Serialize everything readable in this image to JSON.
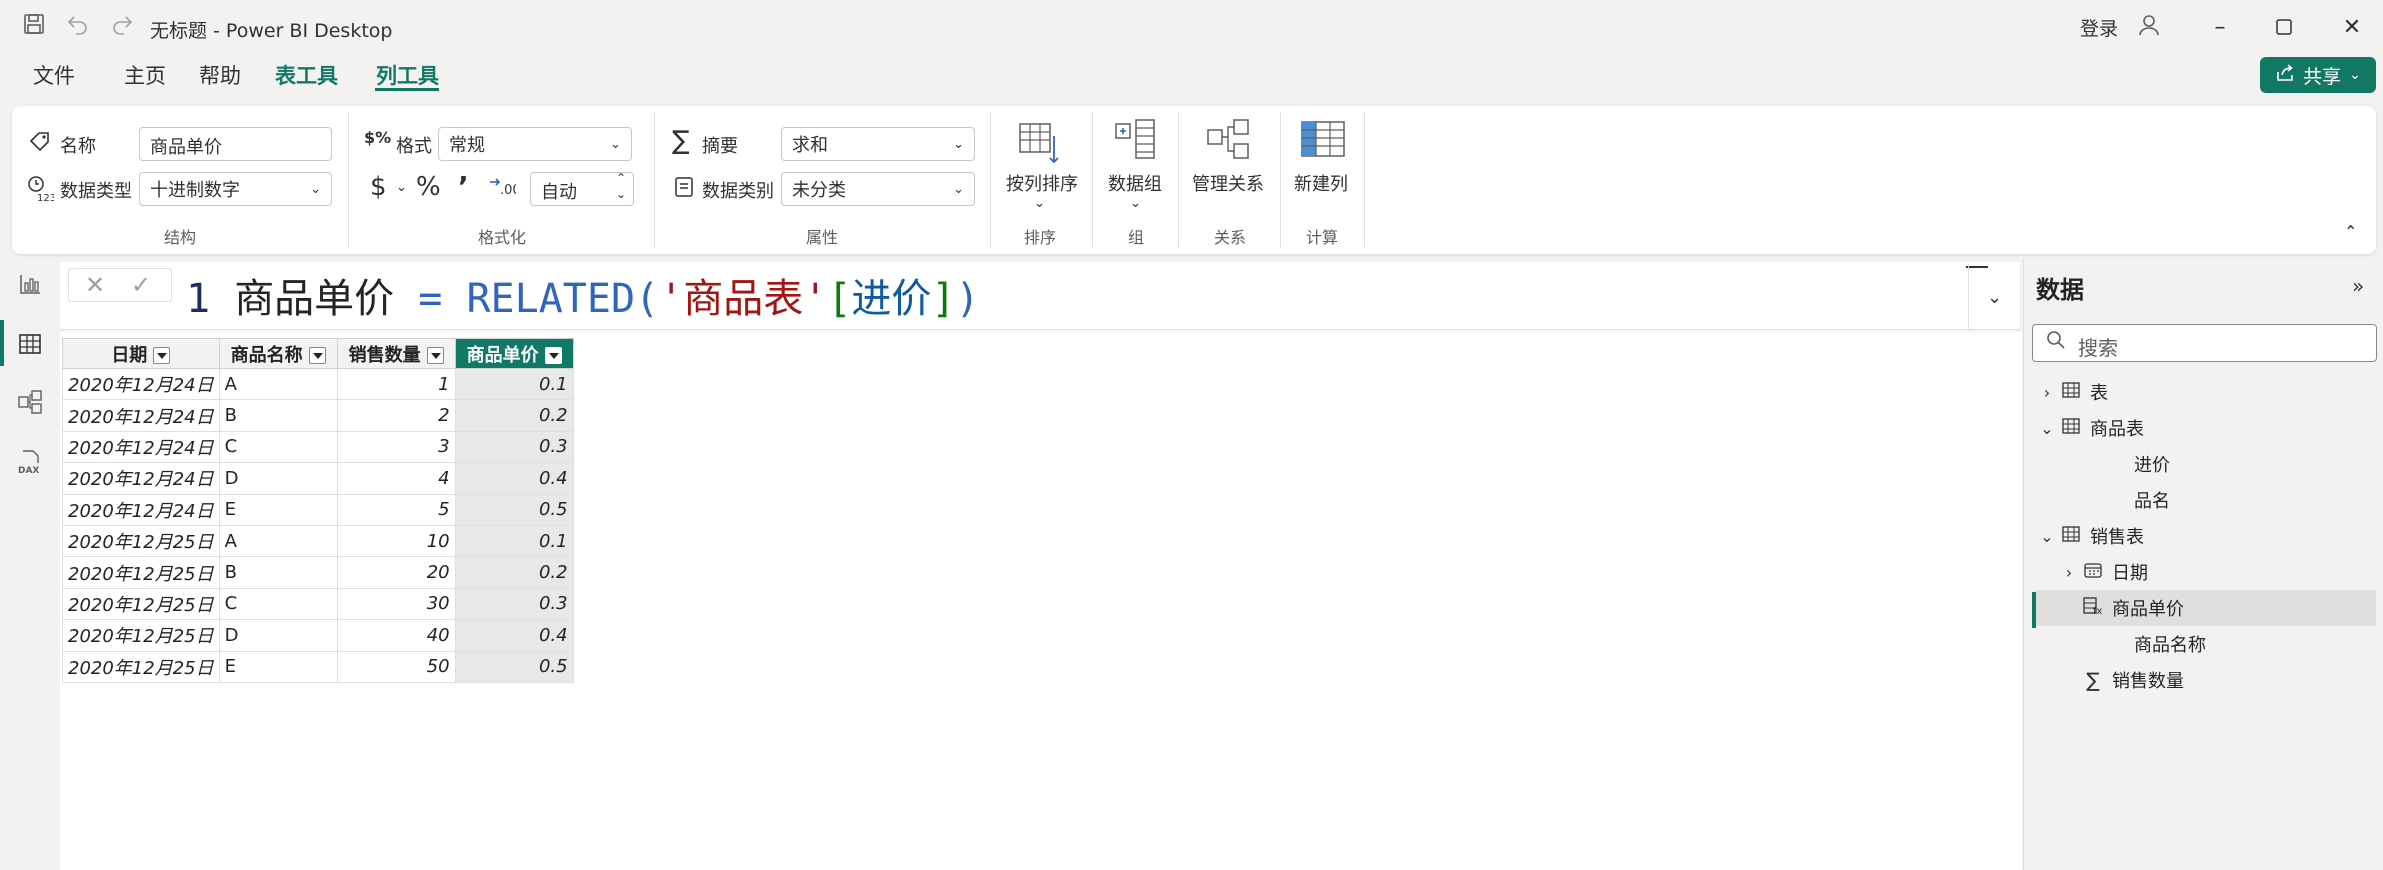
{
  "window": {
    "title": "无标题 - Power BI Desktop",
    "login": "登录"
  },
  "menu": {
    "file": "文件",
    "home": "主页",
    "help": "帮助",
    "table_tools": "表工具",
    "column_tools": "列工具",
    "share": "共享"
  },
  "ribbon": {
    "structure": {
      "name_label": "名称",
      "name_value": "商品单价",
      "datatype_label": "数据类型",
      "datatype_value": "十进制数字",
      "group": "结构"
    },
    "formatting": {
      "format_label": "格式",
      "format_value": "常规",
      "currency": "$",
      "percent": "%",
      "comma": "’",
      "decimals_value": "自动",
      "group": "格式化"
    },
    "properties": {
      "summary_label": "摘要",
      "summary_value": "求和",
      "category_label": "数据类别",
      "category_value": "未分类",
      "group": "属性"
    },
    "sort": {
      "button": "按列排序",
      "group": "排序"
    },
    "groups": {
      "button": "数据组",
      "group": "组"
    },
    "relations": {
      "button": "管理关系",
      "group": "关系"
    },
    "calc": {
      "button": "新建列",
      "group": "计算"
    }
  },
  "formula": {
    "line_no": "1",
    "name": "商品单价",
    "eq": "=",
    "func": "RELATED",
    "open": "(",
    "table": "'商品表'",
    "bracket_open": "[",
    "column": "进价",
    "bracket_close": "]",
    "close": ")"
  },
  "table": {
    "headers": [
      "日期",
      "商品名称",
      "销售数量",
      "商品单价"
    ],
    "rows": [
      [
        "2020年12月24日",
        "A",
        "1",
        "0.1"
      ],
      [
        "2020年12月24日",
        "B",
        "2",
        "0.2"
      ],
      [
        "2020年12月24日",
        "C",
        "3",
        "0.3"
      ],
      [
        "2020年12月24日",
        "D",
        "4",
        "0.4"
      ],
      [
        "2020年12月24日",
        "E",
        "5",
        "0.5"
      ],
      [
        "2020年12月25日",
        "A",
        "10",
        "0.1"
      ],
      [
        "2020年12月25日",
        "B",
        "20",
        "0.2"
      ],
      [
        "2020年12月25日",
        "C",
        "30",
        "0.3"
      ],
      [
        "2020年12月25日",
        "D",
        "40",
        "0.4"
      ],
      [
        "2020年12月25日",
        "E",
        "50",
        "0.5"
      ]
    ]
  },
  "datapane": {
    "title": "数据",
    "search_placeholder": "搜索",
    "tree": [
      {
        "label": "表",
        "chevron": "›",
        "icon": "table-icon"
      },
      {
        "label": "商品表",
        "chevron": "⌄",
        "icon": "table-icon"
      },
      {
        "label": "进价"
      },
      {
        "label": "品名"
      },
      {
        "label": "销售表",
        "chevron": "⌄",
        "icon": "table-icon"
      },
      {
        "label": "日期",
        "chevron": "›",
        "icon": "calendar-icon"
      },
      {
        "label": "商品单价",
        "icon": "calculated-column-icon",
        "active": true
      },
      {
        "label": "商品名称"
      },
      {
        "label": "销售数量",
        "icon": "sigma-icon"
      }
    ]
  },
  "colors": {
    "accent": "#117865",
    "formula_function": "#3165bb",
    "formula_string": "#a31515"
  }
}
